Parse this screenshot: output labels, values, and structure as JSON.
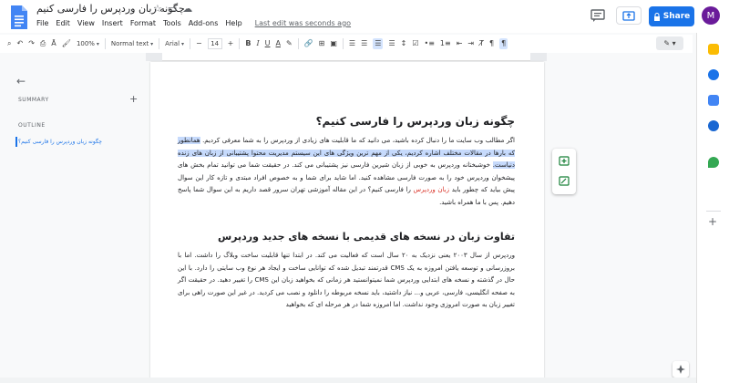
{
  "app": {
    "doc_title": "چگونه زبان وردپرس را فارسی کنیم",
    "menu": [
      "File",
      "Edit",
      "View",
      "Insert",
      "Format",
      "Tools",
      "Add-ons",
      "Help"
    ],
    "last_edit": "Last edit was seconds ago"
  },
  "header": {
    "share_label": "Share",
    "avatar_initial": "M"
  },
  "toolbar": {
    "zoom": "100%",
    "style": "Normal text",
    "font": "Arial",
    "font_size": "14",
    "bold": "B",
    "italic": "I",
    "underline": "U",
    "text_color": "A"
  },
  "sidebar": {
    "summary_label": "SUMMARY",
    "summary_add": "+",
    "outline_label": "OUTLINE",
    "outline_items": [
      "چگونه زبان وردپرس را فارسی کنیم؟"
    ]
  },
  "document": {
    "heading1": "چگونه زبان وردپرس را فارسی کنیم؟",
    "para1_a": "اگر مطالب وب سایت ما را دنبال کرده باشید، می دانید که ما قابلیت های زیادی از وردپرس را به شما معرفی کردیم. ",
    "para1_hl": "همانطور که بارها در مقالات مختلف اشاره کردیم، یکی از مهم ترین ویژگی های این سیستم مدیریت محتوا پشتیبانی از زبان های زنده دنیاست.",
    "para1_b": " خوشبختانه وردپرس به خوبی از زبان شیرین فارسی نیز پشتیبانی می کند. در حقیقت شما می توانید تمام بخش های پیشخوان وردپرس خود را به صورت فارسی مشاهده کنید. اما شاید برای شما و به خصوص افراد مبتدی و تازه کار این سوال پیش بیاید که چطور باید ",
    "para1_link": "زبان وردپرس",
    "para1_c": " را فارسی کنیم؟ در این مقاله آموزشی تهران سرور قصد داریم به این سوال شما پاسخ دهیم. پس با ما همراه باشید.",
    "heading2": "تفاوت زبان در نسخه های قدیمی با نسخه های جدید وردپرس",
    "para2": "وردپرس از سال ۲۰۰۳ یعنی نزدیک به ۲۰ سال است که فعالیت می کند. در ابتدا تنها قابلیت ساخت وبلاگ را داشت. اما با بروزرسانی و توسعه یافتن امروزه به یک CMS قدرتمند تبدیل شده که توانایی ساخت و ایجاد هر نوع وب سایتی را دارد. با این حال در گذشته و نسخه های ابتدایی وردپرس شما نمیتوانستید هر زمانی که بخواهید زبان این CMS را تغییر دهید. در حقیقت اگر به صفحه انگلیسی، فارسی، عربی و... نیاز داشتید، باید نسخه مربوطه را دانلود و نصب می کردید. در غیر این صورت راهی برای تغییر زبان به صورت امروزی وجود نداشت. اما امروزه شما در هر مرحله ای که بخواهید"
  },
  "colors": {
    "accent": "#1a73e8",
    "highlight": "#c6dafc",
    "link": "#d93025",
    "avatar": "#6a1b9a"
  }
}
